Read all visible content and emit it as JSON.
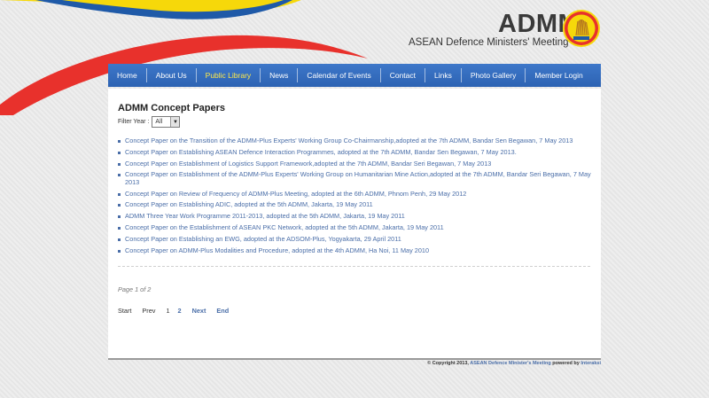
{
  "header": {
    "title": "ADMM",
    "subtitle": "ASEAN Defence Ministers' Meeting",
    "logo_icon": "asean-emblem-icon",
    "colors": {
      "red": "#e8312c",
      "yellow": "#f6d80a",
      "blue": "#1f5aa8"
    }
  },
  "nav": {
    "items": [
      {
        "label": "Home"
      },
      {
        "label": "About Us"
      },
      {
        "label": "Public Library"
      },
      {
        "label": "News"
      },
      {
        "label": "Calendar of Events"
      },
      {
        "label": "Contact"
      },
      {
        "label": "Links"
      },
      {
        "label": "Photo Gallery"
      },
      {
        "label": "Member Login"
      }
    ],
    "active": "Public Library",
    "color": "#2f66b8"
  },
  "main": {
    "title": "ADMM Concept Papers",
    "filter_label": "Filter Year :",
    "filter_value": "All",
    "papers": [
      "Concept Paper on the Transition of the ADMM-Plus Experts' Working Group Co-Chairmanship,adopted at the 7th ADMM, Bandar Sen Begawan, 7 May 2013",
      "Concept Paper on Establishing ASEAN Defence Interaction Programmes, adopted at the 7th ADMM, Bandar Sen Begawan, 7 May 2013.",
      "Concept Paper on Establishment of Logistics Support Framework,adopted at the 7th ADMM, Bandar Seri Begawan, 7 May 2013",
      "Concept Paper on Establishment of the ADMM-Plus Experts' Working Group on Humanitarian Mine Action,adopted at the 7th ADMM, Bandar Seri Begawan, 7 May 2013",
      "Concept Paper on Review of Frequency of ADMM-Plus Meeting, adopted at the 6th ADMM, Phnom Penh, 29 May 2012",
      "Concept Paper on Establishing ADIC, adopted at the 5th ADMM, Jakarta, 19 May 2011",
      "ADMM Three Year Work Programme 2011-2013, adopted at the 5th ADMM, Jakarta, 19 May 2011",
      "Concept Paper on the Establishment of ASEAN PKC Network, adopted at the 5th ADMM, Jakarta, 19 May 2011",
      "Concept Paper on Establishing an EWG, adopted at the ADSOM-Plus, Yogyakarta, 29 April 2011",
      "Concept Paper on ADMM-Plus Modalities and Procedure, adopted at the 4th ADMM, Ha Noi, 11 May 2010"
    ],
    "page_info": "Page 1 of 2",
    "pager": {
      "start": "Start",
      "prev": "Prev",
      "current": "1",
      "page2": "2",
      "next": "Next",
      "end": "End"
    }
  },
  "footer": {
    "copyright": "© Copyright 2013,",
    "site_link": "ASEAN Defence Minister's Meeting",
    "powered": "powered by",
    "powered_link": "Interaksi"
  }
}
